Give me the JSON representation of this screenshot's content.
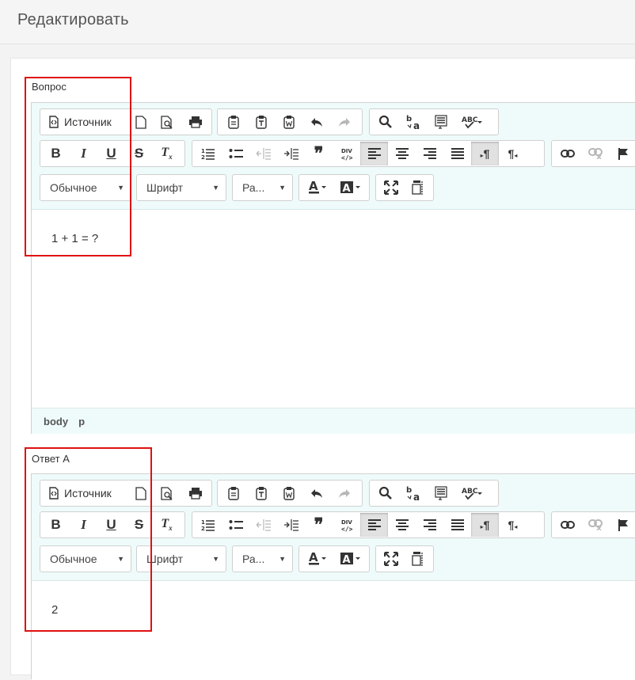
{
  "header": {
    "title": "Редактировать"
  },
  "question": {
    "label": "Вопрос",
    "content": "1 + 1 = ?",
    "path": [
      "body",
      "p"
    ]
  },
  "answer_a": {
    "label": "Ответ А",
    "content": "2"
  },
  "toolbar": {
    "source_label": "Источник",
    "format_combo": "Обычное",
    "font_combo": "Шрифт",
    "size_combo": "Ра...",
    "icons": {
      "source": "source-icon",
      "new_page": "new-page-icon",
      "preview": "preview-icon",
      "print": "print-icon",
      "paste": "paste-icon",
      "paste_text": "paste-text-icon",
      "paste_word": "paste-word-icon",
      "undo": "undo-icon",
      "redo": "redo-icon",
      "find": "find-icon",
      "replace": "replace-icon",
      "select_all": "select-all-icon",
      "spellcheck": "spellcheck-icon",
      "bold": "bold-icon",
      "italic": "italic-icon",
      "underline": "underline-icon",
      "strike": "strikethrough-icon",
      "remove_format": "remove-format-icon",
      "numbered_list": "numbered-list-icon",
      "bulleted_list": "bulleted-list-icon",
      "outdent": "outdent-icon",
      "indent": "indent-icon",
      "blockquote": "blockquote-icon",
      "div": "div-container-icon",
      "align_left": "align-left-icon",
      "align_center": "align-center-icon",
      "align_right": "align-right-icon",
      "justify": "justify-icon",
      "ltr": "text-direction-ltr-icon",
      "rtl": "text-direction-rtl-icon",
      "link": "link-icon",
      "unlink": "unlink-icon",
      "anchor": "anchor-flag-icon",
      "text_color": "text-color-icon",
      "bg_color": "background-color-icon",
      "maximize": "maximize-icon",
      "show_blocks": "show-blocks-icon"
    }
  },
  "colors": {
    "highlight": "#e01010",
    "toolbar_bg": "#eefbfa"
  }
}
